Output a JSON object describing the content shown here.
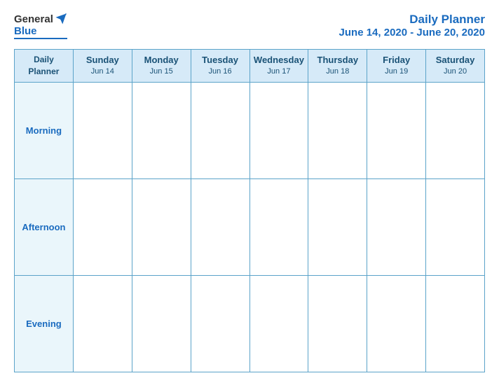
{
  "header": {
    "logo": {
      "general": "General",
      "blue": "Blue",
      "bird_unicode": "🐦"
    },
    "title": "Daily Planner",
    "date_range": "June 14, 2020 - June 20, 2020"
  },
  "table": {
    "label_header_line1": "Daily",
    "label_header_line2": "Planner",
    "days": [
      {
        "name": "Sunday",
        "date": "Jun 14"
      },
      {
        "name": "Monday",
        "date": "Jun 15"
      },
      {
        "name": "Tuesday",
        "date": "Jun 16"
      },
      {
        "name": "Wednesday",
        "date": "Jun 17"
      },
      {
        "name": "Thursday",
        "date": "Jun 18"
      },
      {
        "name": "Friday",
        "date": "Jun 19"
      },
      {
        "name": "Saturday",
        "date": "Jun 20"
      }
    ],
    "rows": [
      {
        "label": "Morning"
      },
      {
        "label": "Afternoon"
      },
      {
        "label": "Evening"
      }
    ]
  }
}
